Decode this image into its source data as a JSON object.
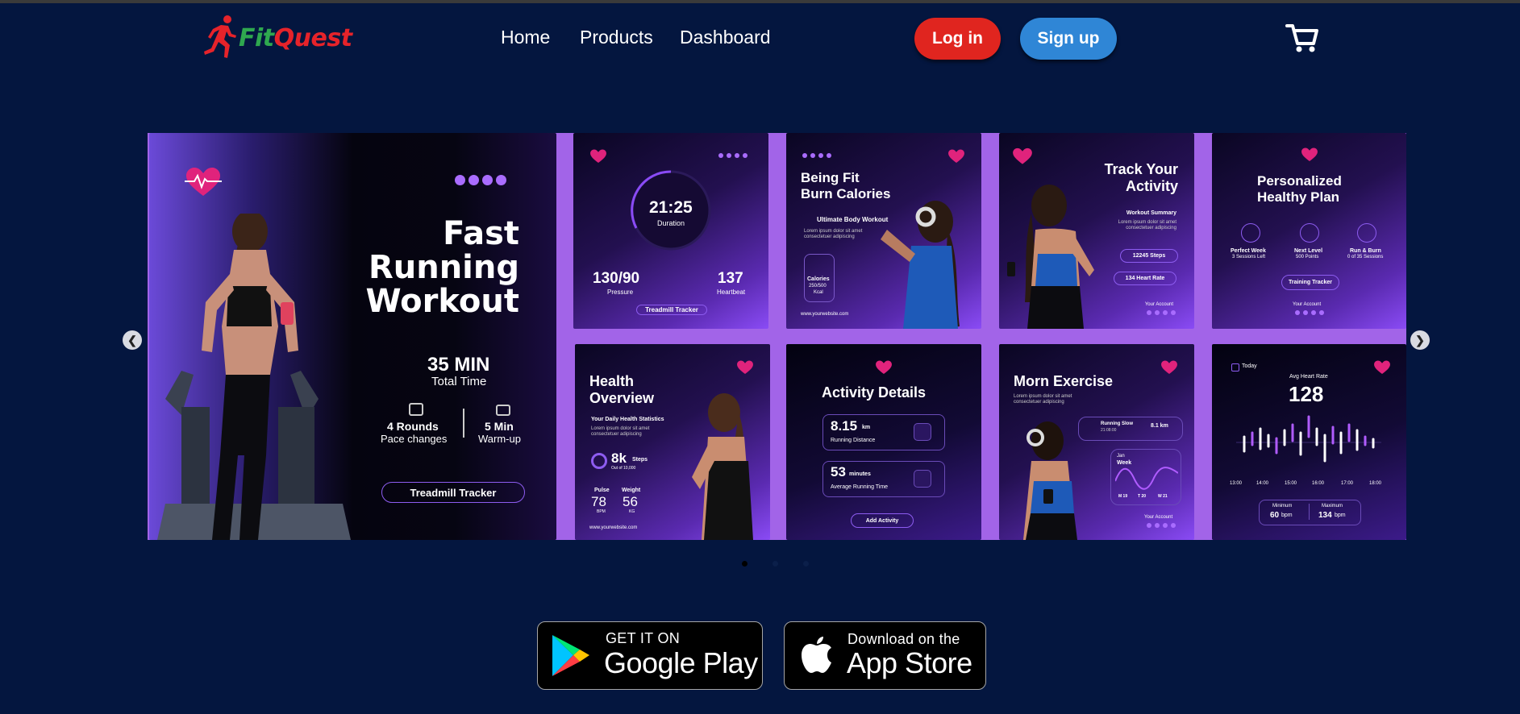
{
  "brand": {
    "name_part1": "Fit",
    "name_part2": "Quest"
  },
  "nav": {
    "items": [
      "Home",
      "Products",
      "Dashboard"
    ]
  },
  "auth": {
    "login_label": "Log in",
    "signup_label": "Sign up"
  },
  "icons": {
    "cart": "cart-icon",
    "logo": "runner-icon",
    "prev": "chevron-left-icon",
    "next": "chevron-right-icon"
  },
  "colors": {
    "background": "#04163f",
    "login": "#e0251f",
    "signup": "#2f86d6",
    "accent": "#a264e8"
  },
  "carousel": {
    "slides_count": 3,
    "active_slide": 1,
    "hero": {
      "title": [
        "Fast",
        "Running",
        "Workout"
      ],
      "duration_value": "35 MIN",
      "duration_label": "Total Time",
      "rounds_value": "4 Rounds",
      "rounds_label": "Pace changes",
      "warmup_value": "5 Min",
      "warmup_label": "Warm-up",
      "button": "Treadmill Tracker"
    },
    "duration_card": {
      "time": "21:25",
      "time_label": "Duration",
      "pressure_value": "130/90",
      "pressure_label": "Pressure",
      "heartbeat_value": "137",
      "heartbeat_label": "Heartbeat",
      "button": "Treadmill Tracker"
    },
    "calories_card": {
      "title": [
        "Being Fit",
        "Burn Calories"
      ],
      "subtitle": "Ultimate Body Workout",
      "body": [
        "Lorem ipsum dolor sit amet",
        "consectetuer adipiscing"
      ],
      "calories_label": "Calories",
      "calories_value": "250/500",
      "calories_unit": "Kcal",
      "website": "www.yourwebsite.com"
    },
    "track_card": {
      "title": [
        "Track Your",
        "Activity"
      ],
      "subtitle": "Workout Summary",
      "body": [
        "Lorem ipsum dolor sit amet",
        "consectetuer adipiscing"
      ],
      "steps": "12245 Steps",
      "heart_rate": "134 Heart Rate",
      "account": "Your Account"
    },
    "plan_card": {
      "title": [
        "Personalized",
        "Healthy Plan"
      ],
      "items": [
        {
          "title": "Perfect Week",
          "sub": "3 Sessions Left"
        },
        {
          "title": "Next Level",
          "sub": "500 Points"
        },
        {
          "title": "Run & Burn",
          "sub": "0 of 35 Sessions"
        }
      ],
      "button": "Training Tracker",
      "account": "Your Account"
    },
    "health_card": {
      "title": [
        "Health",
        "Overview"
      ],
      "subtitle": "Your Daily Health Statistics",
      "body": [
        "Lorem ipsum dolor sit amet",
        "consectetuer adipiscing"
      ],
      "steps_value": "8k",
      "steps_unit": "Steps",
      "steps_sub": "Out of 10,000",
      "pulse_label": "Pulse",
      "pulse_value": "78",
      "pulse_unit": "BPM",
      "weight_label": "Weight",
      "weight_value": "56",
      "weight_unit": "KG",
      "website": "www.yourwebsite.com"
    },
    "activity_card": {
      "title": "Activity Details",
      "distance_value": "8.15",
      "distance_unit": "km",
      "distance_label": "Running Distance",
      "time_value": "53",
      "time_unit": "minutes",
      "time_label": "Average Running Time",
      "button": "Add Activity"
    },
    "morn_card": {
      "title": "Morn Exercise",
      "body": [
        "Lorem ipsum dolor sit amet",
        "consectetuer adipiscing"
      ],
      "run_label": "Running Slow",
      "run_time": "21:08:00",
      "run_distance": "8.1 km",
      "month": "Jan",
      "period": "Week",
      "days": [
        "M 19",
        "T 20",
        "W 21"
      ],
      "account": "Your Account"
    },
    "heart_card": {
      "today": "Today",
      "label": "Avg Heart Rate",
      "value": "128",
      "times": [
        "13:00",
        "14:00",
        "15:00",
        "16:00",
        "17:00",
        "18:00"
      ],
      "min_label": "Minimum",
      "min_value": "60",
      "max_label": "Maximum",
      "max_value": "134",
      "unit": "bpm"
    }
  },
  "stores": {
    "google": {
      "small": "GET IT ON",
      "big": "Google Play"
    },
    "apple": {
      "small": "Download on the",
      "big": "App Store"
    }
  }
}
